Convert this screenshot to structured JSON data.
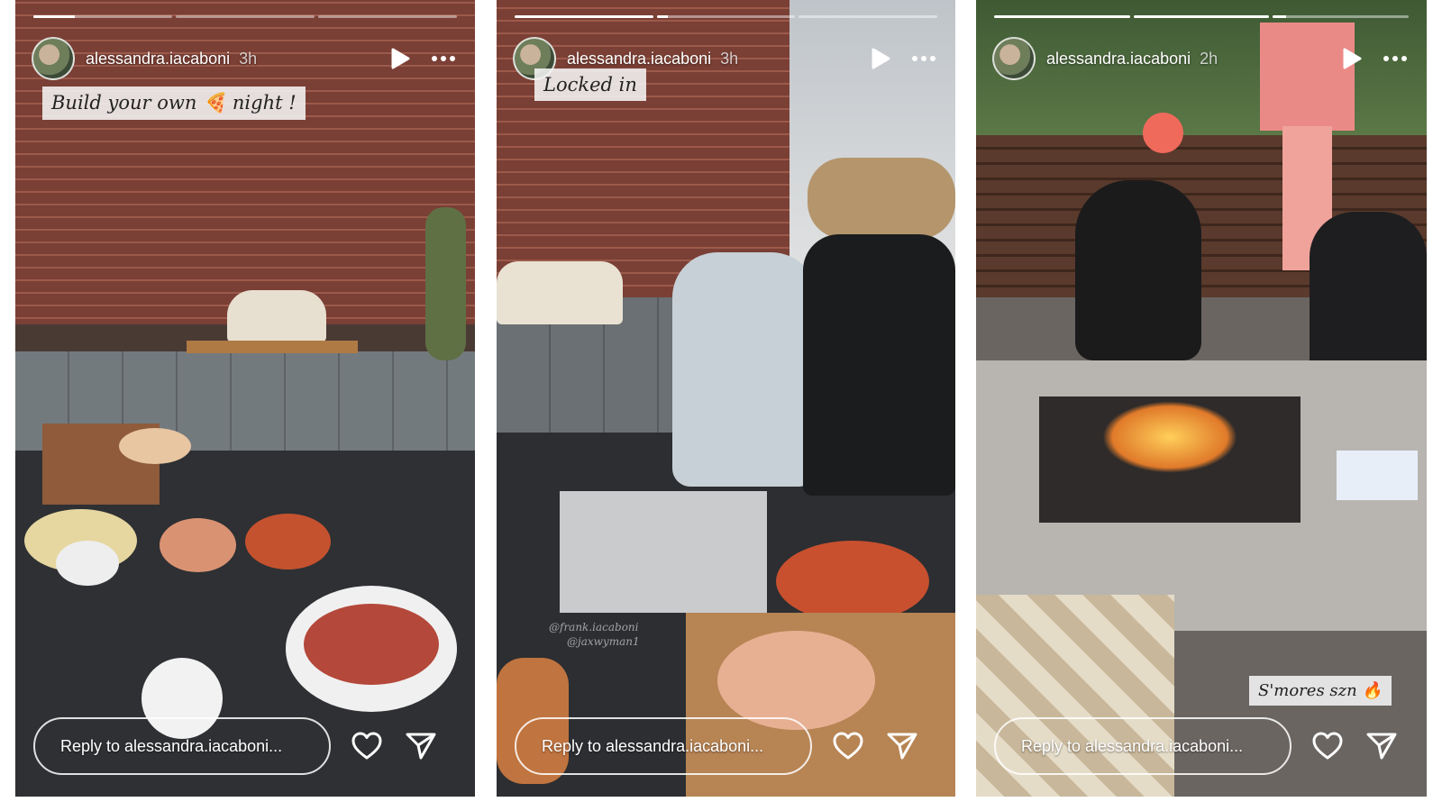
{
  "stories": [
    {
      "username": "alessandra.iacaboni",
      "time": "3h",
      "progress": [
        0.3,
        0,
        0
      ],
      "sticker": "Build your own 🍕 night !",
      "mentions": [],
      "reply_placeholder": "Reply to alessandra.iacaboni...",
      "icons": {
        "play": "play-icon",
        "more": "more-icon",
        "like": "heart-icon",
        "share": "send-icon"
      }
    },
    {
      "username": "alessandra.iacaboni",
      "time": "3h",
      "progress": [
        1,
        0.08,
        0
      ],
      "sticker": "Locked in",
      "mentions": [
        "@frank.iacaboni",
        "@jaxwyman1"
      ],
      "reply_placeholder": "Reply to alessandra.iacaboni...",
      "icons": {
        "play": "play-icon",
        "more": "more-icon",
        "like": "heart-icon",
        "share": "send-icon"
      }
    },
    {
      "username": "alessandra.iacaboni",
      "time": "2h",
      "progress": [
        1,
        1,
        0.1
      ],
      "sticker": "S'mores szn 🔥",
      "mentions": [],
      "reply_placeholder": "Reply to alessandra.iacaboni...",
      "icons": {
        "play": "play-icon",
        "more": "more-icon",
        "like": "heart-icon",
        "share": "send-icon"
      }
    }
  ]
}
